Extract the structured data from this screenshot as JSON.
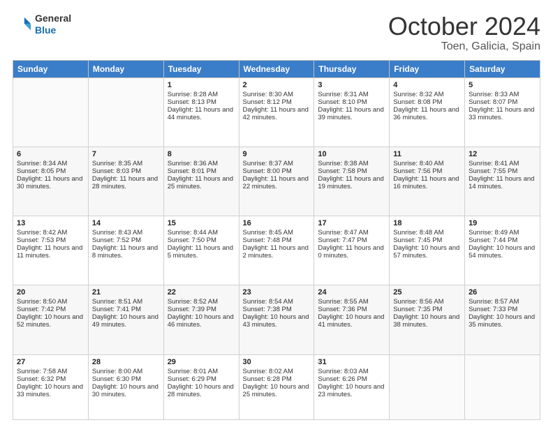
{
  "header": {
    "logo_general": "General",
    "logo_blue": "Blue",
    "month": "October 2024",
    "location": "Toen, Galicia, Spain"
  },
  "days_of_week": [
    "Sunday",
    "Monday",
    "Tuesday",
    "Wednesday",
    "Thursday",
    "Friday",
    "Saturday"
  ],
  "weeks": [
    [
      {
        "day": "",
        "info": ""
      },
      {
        "day": "",
        "info": ""
      },
      {
        "day": "1",
        "info": "Sunrise: 8:28 AM\nSunset: 8:13 PM\nDaylight: 11 hours and 44 minutes."
      },
      {
        "day": "2",
        "info": "Sunrise: 8:30 AM\nSunset: 8:12 PM\nDaylight: 11 hours and 42 minutes."
      },
      {
        "day": "3",
        "info": "Sunrise: 8:31 AM\nSunset: 8:10 PM\nDaylight: 11 hours and 39 minutes."
      },
      {
        "day": "4",
        "info": "Sunrise: 8:32 AM\nSunset: 8:08 PM\nDaylight: 11 hours and 36 minutes."
      },
      {
        "day": "5",
        "info": "Sunrise: 8:33 AM\nSunset: 8:07 PM\nDaylight: 11 hours and 33 minutes."
      }
    ],
    [
      {
        "day": "6",
        "info": "Sunrise: 8:34 AM\nSunset: 8:05 PM\nDaylight: 11 hours and 30 minutes."
      },
      {
        "day": "7",
        "info": "Sunrise: 8:35 AM\nSunset: 8:03 PM\nDaylight: 11 hours and 28 minutes."
      },
      {
        "day": "8",
        "info": "Sunrise: 8:36 AM\nSunset: 8:01 PM\nDaylight: 11 hours and 25 minutes."
      },
      {
        "day": "9",
        "info": "Sunrise: 8:37 AM\nSunset: 8:00 PM\nDaylight: 11 hours and 22 minutes."
      },
      {
        "day": "10",
        "info": "Sunrise: 8:38 AM\nSunset: 7:58 PM\nDaylight: 11 hours and 19 minutes."
      },
      {
        "day": "11",
        "info": "Sunrise: 8:40 AM\nSunset: 7:56 PM\nDaylight: 11 hours and 16 minutes."
      },
      {
        "day": "12",
        "info": "Sunrise: 8:41 AM\nSunset: 7:55 PM\nDaylight: 11 hours and 14 minutes."
      }
    ],
    [
      {
        "day": "13",
        "info": "Sunrise: 8:42 AM\nSunset: 7:53 PM\nDaylight: 11 hours and 11 minutes."
      },
      {
        "day": "14",
        "info": "Sunrise: 8:43 AM\nSunset: 7:52 PM\nDaylight: 11 hours and 8 minutes."
      },
      {
        "day": "15",
        "info": "Sunrise: 8:44 AM\nSunset: 7:50 PM\nDaylight: 11 hours and 5 minutes."
      },
      {
        "day": "16",
        "info": "Sunrise: 8:45 AM\nSunset: 7:48 PM\nDaylight: 11 hours and 2 minutes."
      },
      {
        "day": "17",
        "info": "Sunrise: 8:47 AM\nSunset: 7:47 PM\nDaylight: 11 hours and 0 minutes."
      },
      {
        "day": "18",
        "info": "Sunrise: 8:48 AM\nSunset: 7:45 PM\nDaylight: 10 hours and 57 minutes."
      },
      {
        "day": "19",
        "info": "Sunrise: 8:49 AM\nSunset: 7:44 PM\nDaylight: 10 hours and 54 minutes."
      }
    ],
    [
      {
        "day": "20",
        "info": "Sunrise: 8:50 AM\nSunset: 7:42 PM\nDaylight: 10 hours and 52 minutes."
      },
      {
        "day": "21",
        "info": "Sunrise: 8:51 AM\nSunset: 7:41 PM\nDaylight: 10 hours and 49 minutes."
      },
      {
        "day": "22",
        "info": "Sunrise: 8:52 AM\nSunset: 7:39 PM\nDaylight: 10 hours and 46 minutes."
      },
      {
        "day": "23",
        "info": "Sunrise: 8:54 AM\nSunset: 7:38 PM\nDaylight: 10 hours and 43 minutes."
      },
      {
        "day": "24",
        "info": "Sunrise: 8:55 AM\nSunset: 7:36 PM\nDaylight: 10 hours and 41 minutes."
      },
      {
        "day": "25",
        "info": "Sunrise: 8:56 AM\nSunset: 7:35 PM\nDaylight: 10 hours and 38 minutes."
      },
      {
        "day": "26",
        "info": "Sunrise: 8:57 AM\nSunset: 7:33 PM\nDaylight: 10 hours and 35 minutes."
      }
    ],
    [
      {
        "day": "27",
        "info": "Sunrise: 7:58 AM\nSunset: 6:32 PM\nDaylight: 10 hours and 33 minutes."
      },
      {
        "day": "28",
        "info": "Sunrise: 8:00 AM\nSunset: 6:30 PM\nDaylight: 10 hours and 30 minutes."
      },
      {
        "day": "29",
        "info": "Sunrise: 8:01 AM\nSunset: 6:29 PM\nDaylight: 10 hours and 28 minutes."
      },
      {
        "day": "30",
        "info": "Sunrise: 8:02 AM\nSunset: 6:28 PM\nDaylight: 10 hours and 25 minutes."
      },
      {
        "day": "31",
        "info": "Sunrise: 8:03 AM\nSunset: 6:26 PM\nDaylight: 10 hours and 23 minutes."
      },
      {
        "day": "",
        "info": ""
      },
      {
        "day": "",
        "info": ""
      }
    ]
  ]
}
